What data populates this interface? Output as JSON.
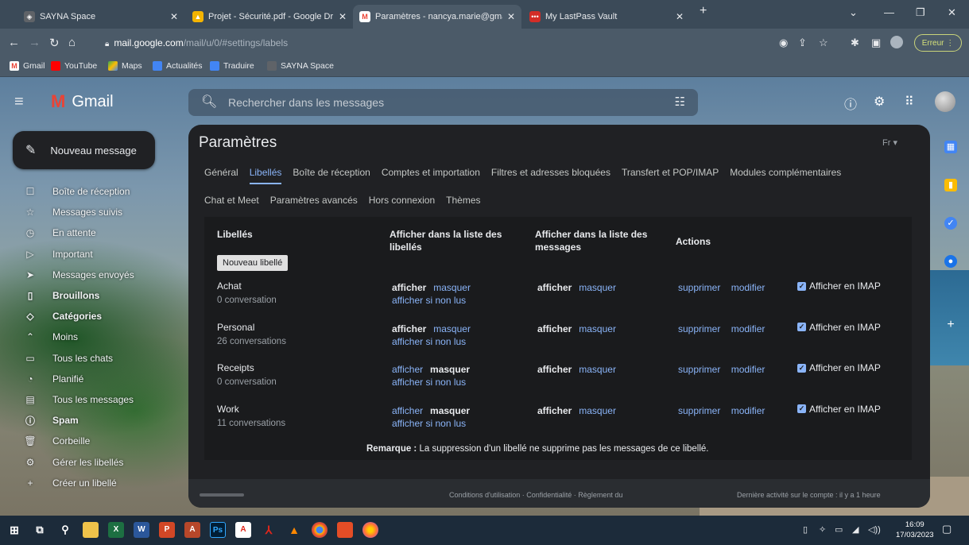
{
  "browser": {
    "tabs": [
      {
        "title": "SAYNA Space",
        "icon": "sayna-icon"
      },
      {
        "title": "Projet - Sécurité.pdf - Google Dr",
        "icon": "google-drive-icon"
      },
      {
        "title": "Paramètres - nancya.marie@gma",
        "icon": "gmail-icon",
        "active": true
      },
      {
        "title": "My LastPass Vault",
        "icon": "lastpass-icon"
      }
    ],
    "new_tab": "+",
    "url_host": "mail.google.com",
    "url_path": "/mail/u/0/#settings/labels",
    "error_button": "Erreur",
    "bookmarks": [
      "Gmail",
      "YouTube",
      "Maps",
      "Actualités",
      "Traduire",
      "SAYNA Space"
    ]
  },
  "gmail": {
    "logo_text": "Gmail",
    "search_placeholder": "Rechercher dans les messages",
    "compose_label": "Nouveau message",
    "nav": [
      {
        "label": "Boîte de réception",
        "icon": "inbox-icon"
      },
      {
        "label": "Messages suivis",
        "icon": "star-icon"
      },
      {
        "label": "En attente",
        "icon": "clock-icon"
      },
      {
        "label": "Important",
        "icon": "important-icon"
      },
      {
        "label": "Messages envoyés",
        "icon": "send-icon"
      },
      {
        "label": "Brouillons",
        "icon": "draft-icon",
        "bold": true
      },
      {
        "label": "Catégories",
        "icon": "category-icon",
        "bold": true
      },
      {
        "label": "Moins",
        "icon": "chevron-up-icon"
      },
      {
        "label": "Tous les chats",
        "icon": "chat-icon"
      },
      {
        "label": "Planifié",
        "icon": "scheduled-icon"
      },
      {
        "label": "Tous les messages",
        "icon": "all-mail-icon"
      },
      {
        "label": "Spam",
        "icon": "spam-icon",
        "bold": true
      },
      {
        "label": "Corbeille",
        "icon": "trash-icon"
      },
      {
        "label": "Gérer les libellés",
        "icon": "gear-icon"
      },
      {
        "label": "Créer un libellé",
        "icon": "plus-icon"
      }
    ]
  },
  "settings": {
    "title": "Paramètres",
    "lang": "Fr",
    "tabs_row1": [
      "Général",
      "Libellés",
      "Boîte de réception",
      "Comptes et importation",
      "Filtres et adresses bloquées",
      "Transfert et POP/IMAP",
      "Modules complémentaires"
    ],
    "tabs_row2": [
      "Chat et Meet",
      "Paramètres avancés",
      "Hors connexion",
      "Thèmes"
    ],
    "active_tab": "Libellés",
    "headers": {
      "labels": "Libellés",
      "show_in_label_list": "Afficher dans la liste des libellés",
      "show_in_message_list": "Afficher dans la liste des messages",
      "actions": "Actions"
    },
    "new_label_button": "Nouveau libellé",
    "show_word": "afficher",
    "hide_word": "masquer",
    "show_if_unread": "afficher si non lus",
    "delete_word": "supprimer",
    "edit_word": "modifier",
    "imap_label": "Afficher en IMAP",
    "labels": [
      {
        "name": "Achat",
        "count": "0 conversation",
        "list_state": "afficher",
        "msg_state": "afficher"
      },
      {
        "name": "Personal",
        "count": "26 conversations",
        "list_state": "afficher",
        "msg_state": "afficher"
      },
      {
        "name": "Receipts",
        "count": "0 conversation",
        "list_state": "masquer",
        "msg_state": "afficher"
      },
      {
        "name": "Work",
        "count": "11 conversations",
        "list_state": "masquer",
        "msg_state": "afficher"
      }
    ],
    "remark_bold": "Remarque :",
    "remark_text": " La suppression d'un libellé ne supprime pas les messages de ce libellé.",
    "footer_left": "Conditions d'utilisation · Confidentialité · Règlement du",
    "footer_right": "Dernière activité sur le compte : il y a 1 heure"
  },
  "taskbar": {
    "time": "16:09",
    "date": "17/03/2023"
  }
}
